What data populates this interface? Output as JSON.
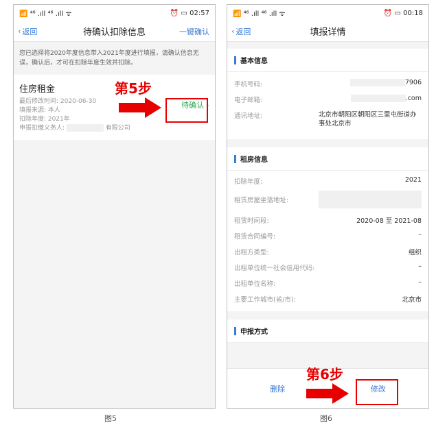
{
  "screen1": {
    "status": {
      "left": "📶 ⁴⁶ .ıll ⁴⁶ .ıll ᯤ",
      "right": "⏰ ▭ 02:57"
    },
    "nav": {
      "back": "返回",
      "title": "待确认扣除信息",
      "right": "一键确认"
    },
    "notice": "您已选择将2020年度信息带入2021年度进行填报，请确认信息无误，确认后，才可在扣除年度生效并扣除。",
    "card": {
      "title": "住房租金",
      "modified": "最后修改时间: 2020-06-30",
      "source": "填报来源: 本人",
      "year": "扣除年度: 2021年",
      "agent_prefix": "申报扣缴义务人:",
      "agent_suffix": "有限公司",
      "pending": "待确认"
    },
    "step": "第5步",
    "caption": "图5"
  },
  "screen2": {
    "status": {
      "left": "📶 ⁴⁶ .ıll ⁴⁶ .ıll ᯤ",
      "right": "⏰ ▭ 00:18"
    },
    "nav": {
      "back": "返回",
      "title": "填报详情"
    },
    "basic": {
      "heading": "基本信息",
      "phone_label": "手机号码:",
      "phone_value": "7906",
      "email_label": "电子邮箱:",
      "email_value": ".com",
      "address_label": "通讯地址:",
      "address_value": "北京市朝阳区朝阳区三里屯街道办事处北京市"
    },
    "rent": {
      "heading": "租房信息",
      "rows": [
        {
          "label": "扣除年度:",
          "value": "2021"
        },
        {
          "label": "租赁房屋坐落地址:",
          "value": ""
        },
        {
          "label": "租赁时间段:",
          "value": "2020-08 至 2021-08"
        },
        {
          "label": "租赁合同编号:",
          "value": "–"
        },
        {
          "label": "出租方类型:",
          "value": "组织"
        },
        {
          "label": "出租单位统一社会信用代码:",
          "value": "–"
        },
        {
          "label": "出租单位名称:",
          "value": "–"
        },
        {
          "label": "主要工作城市(省/市):",
          "value": "北京市"
        }
      ]
    },
    "declare": {
      "heading": "申报方式"
    },
    "buttons": {
      "delete": "删除",
      "modify": "修改"
    },
    "step": "第6步",
    "caption": "图6"
  },
  "colors": {
    "accent": "#3a7bd5",
    "highlight": "#e60000",
    "pending": "#2aa74f"
  }
}
